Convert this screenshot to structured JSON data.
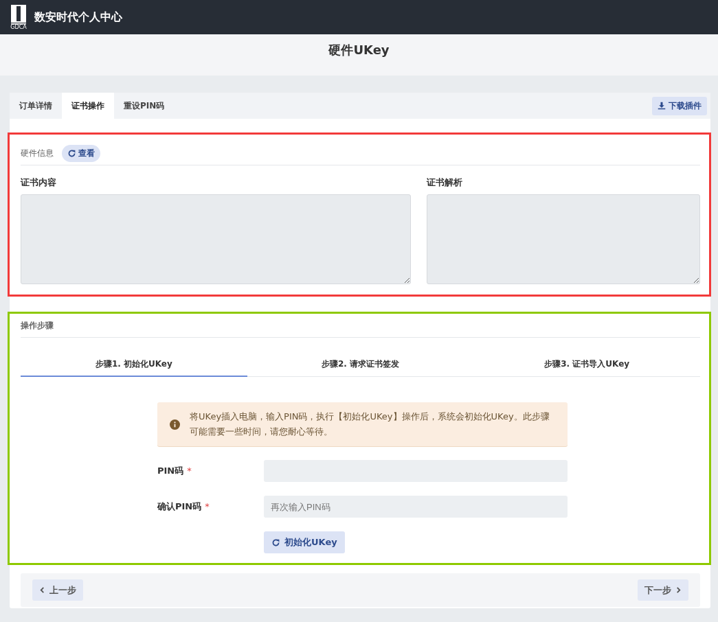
{
  "header": {
    "logo_text": "GDCA",
    "title": "数安时代个人中心"
  },
  "page_title": "硬件UKey",
  "tabs": [
    {
      "label": "订单详情",
      "selected": false
    },
    {
      "label": "证书操作",
      "selected": true
    },
    {
      "label": "重设PIN码",
      "selected": false
    }
  ],
  "download_button": "下载插件",
  "hardware_section": {
    "color": "#f23a3a",
    "title": "硬件信息",
    "view_button": "查看",
    "panels": [
      {
        "label": "证书内容"
      },
      {
        "label": "证书解析"
      }
    ]
  },
  "steps_section": {
    "color": "#8ec900",
    "title": "操作步骤",
    "steps": [
      {
        "label": "步骤1. 初始化UKey",
        "selected": true
      },
      {
        "label": "步骤2. 请求证书签发",
        "selected": false
      },
      {
        "label": "步骤3. 证书导入UKey",
        "selected": false
      }
    ],
    "alert": "将UKey插入电脑，输入PIN码，执行【初始化UKey】操作后，系统会初始化UKey。此步骤可能需要一些时间，请您耐心等待。",
    "fields": [
      {
        "label": "PIN码",
        "required_mark": "*"
      },
      {
        "label": "确认PIN码",
        "required_mark": "*",
        "placeholder": "再次输入PIN码"
      }
    ],
    "init_button": "初始化UKey"
  },
  "nav": {
    "prev": "上一步",
    "next": "下一步"
  }
}
